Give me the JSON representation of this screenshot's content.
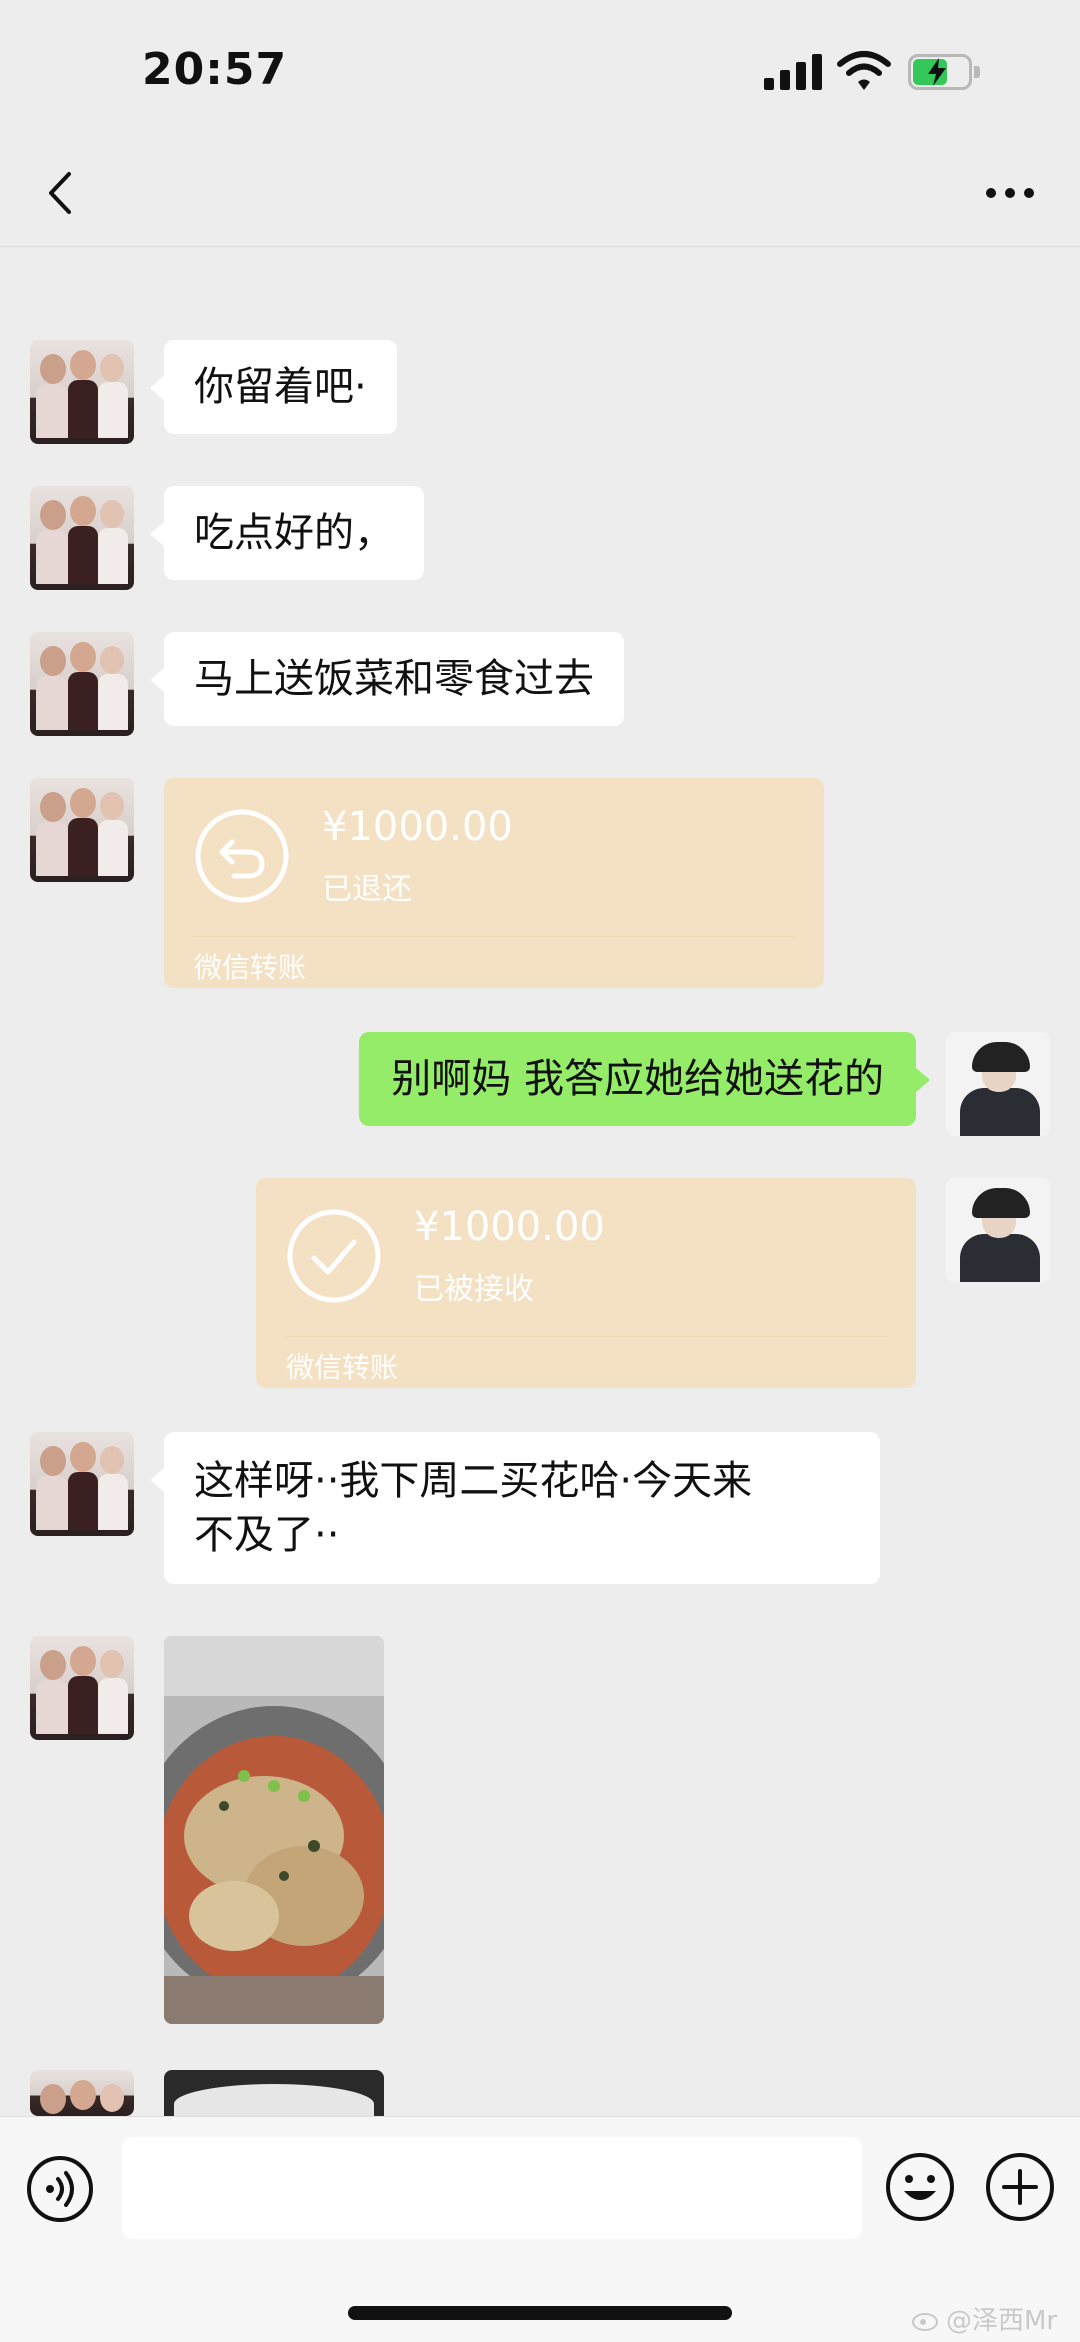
{
  "status_bar": {
    "time": "20:57"
  },
  "nav": {
    "back_icon": "chevron-left-icon",
    "more_icon": "more-dots-icon"
  },
  "messages": [
    {
      "type": "text",
      "side": "in",
      "text": "你留着吧·"
    },
    {
      "type": "text",
      "side": "in",
      "text": "吃点好的，"
    },
    {
      "type": "text",
      "side": "in",
      "text": "马上送饭菜和零食过去"
    },
    {
      "type": "transfer",
      "side": "in",
      "amount": "¥1000.00",
      "status": "已退还",
      "label": "微信转账",
      "icon": "return-arrow-icon"
    },
    {
      "type": "text",
      "side": "out",
      "text": "别啊妈 我答应她给她送花的"
    },
    {
      "type": "transfer",
      "side": "out",
      "amount": "¥1000.00",
      "status": "已被接收",
      "label": "微信转账",
      "icon": "check-icon"
    },
    {
      "type": "text",
      "side": "in",
      "line1": "这样呀··我下周二买花哈·今天来",
      "line2": "不及了··"
    },
    {
      "type": "image",
      "side": "in",
      "alt": "food-photo"
    },
    {
      "type": "image",
      "side": "in",
      "alt": "food-photo-partial"
    }
  ],
  "input_bar": {
    "placeholder": "",
    "voice_icon": "voice-icon",
    "emoji_icon": "emoji-icon",
    "add_icon": "plus-icon"
  },
  "watermark": "@泽西Mr",
  "colors": {
    "background": "#ededed",
    "incoming": "#ffffff",
    "outgoing": "#95ec69",
    "transfer": "#f4e0c2"
  }
}
